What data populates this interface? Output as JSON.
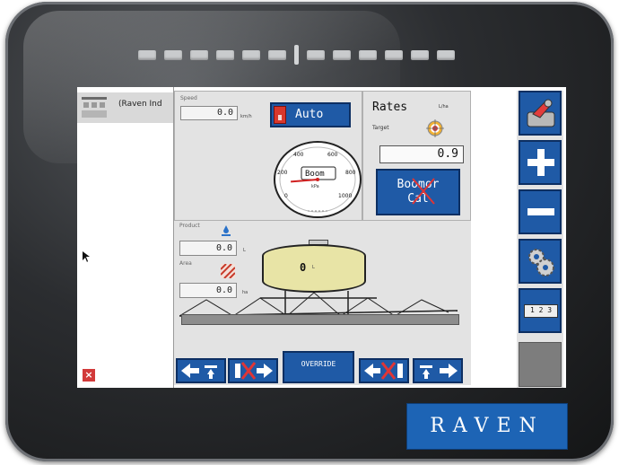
{
  "device": {
    "brand": "RAVEN"
  },
  "file_panel": {
    "item_label": "(Raven Ind",
    "close_glyph": "×"
  },
  "speed": {
    "label": "Speed",
    "value": "0.0",
    "unit": "km/h"
  },
  "mode": {
    "label": "Auto"
  },
  "gauge": {
    "label": "Boom",
    "unit": "kPa",
    "ticks": [
      "0",
      "200",
      "400",
      "600",
      "800",
      "1000"
    ],
    "needle_value": 150
  },
  "rates": {
    "title": "Rates",
    "unit": "L/ha",
    "target_label": "Target",
    "value": "0.9",
    "boom_cal_line1": "Boom",
    "boom_cal_suffix": "or",
    "boom_cal_line2": "Cal"
  },
  "product": {
    "label": "Product",
    "volume": "0.0",
    "volume_unit": "L",
    "area_label": "Area",
    "area": "0.0",
    "area_unit": "ha",
    "tank_value": "0",
    "tank_unit": "L"
  },
  "bottom": {
    "override_label": "OVERRIDE"
  },
  "side": {
    "counter_label": "1 2 3"
  },
  "colors": {
    "button_blue": "#1f5aa6",
    "bezel": "#2b2d30",
    "tank_fill": "#e8e4a6",
    "alert_red": "#d23a3a"
  }
}
